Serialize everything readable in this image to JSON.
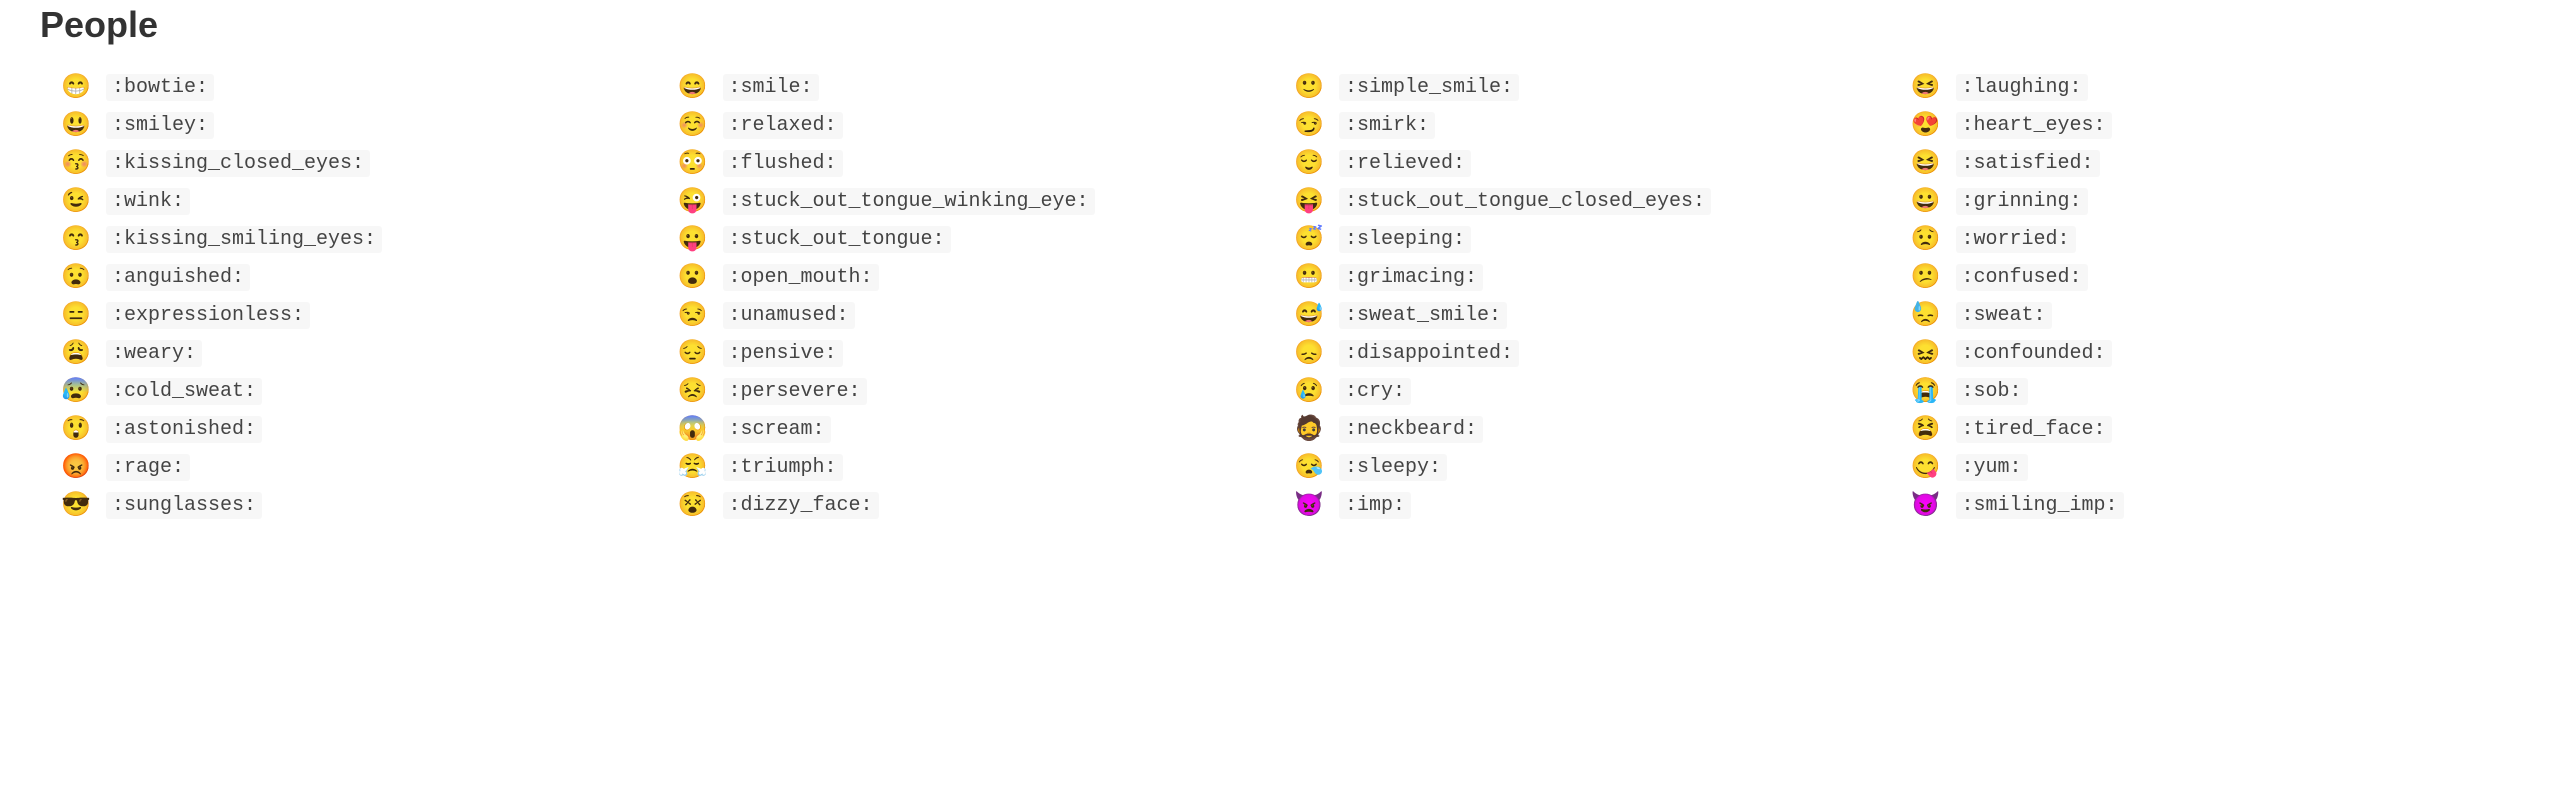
{
  "section": {
    "title": "People"
  },
  "emojis": [
    {
      "name": "bowtie",
      "code": ":bowtie:",
      "glyph": "😁"
    },
    {
      "name": "smile",
      "code": ":smile:",
      "glyph": "😄"
    },
    {
      "name": "simple_smile",
      "code": ":simple_smile:",
      "glyph": "🙂"
    },
    {
      "name": "laughing",
      "code": ":laughing:",
      "glyph": "😆"
    },
    {
      "name": "smiley",
      "code": ":smiley:",
      "glyph": "😃"
    },
    {
      "name": "relaxed",
      "code": ":relaxed:",
      "glyph": "☺️"
    },
    {
      "name": "smirk",
      "code": ":smirk:",
      "glyph": "😏"
    },
    {
      "name": "heart_eyes",
      "code": ":heart_eyes:",
      "glyph": "😍"
    },
    {
      "name": "kissing_closed_eyes",
      "code": ":kissing_closed_eyes:",
      "glyph": "😚"
    },
    {
      "name": "flushed",
      "code": ":flushed:",
      "glyph": "😳"
    },
    {
      "name": "relieved",
      "code": ":relieved:",
      "glyph": "😌"
    },
    {
      "name": "satisfied",
      "code": ":satisfied:",
      "glyph": "😆"
    },
    {
      "name": "wink",
      "code": ":wink:",
      "glyph": "😉"
    },
    {
      "name": "stuck_out_tongue_winking_eye",
      "code": ":stuck_out_tongue_winking_eye:",
      "glyph": "😜"
    },
    {
      "name": "stuck_out_tongue_closed_eyes",
      "code": ":stuck_out_tongue_closed_eyes:",
      "glyph": "😝"
    },
    {
      "name": "grinning",
      "code": ":grinning:",
      "glyph": "😀"
    },
    {
      "name": "kissing_smiling_eyes",
      "code": ":kissing_smiling_eyes:",
      "glyph": "😙"
    },
    {
      "name": "stuck_out_tongue",
      "code": ":stuck_out_tongue:",
      "glyph": "😛"
    },
    {
      "name": "sleeping",
      "code": ":sleeping:",
      "glyph": "😴"
    },
    {
      "name": "worried",
      "code": ":worried:",
      "glyph": "😟"
    },
    {
      "name": "anguished",
      "code": ":anguished:",
      "glyph": "😧"
    },
    {
      "name": "open_mouth",
      "code": ":open_mouth:",
      "glyph": "😮"
    },
    {
      "name": "grimacing",
      "code": ":grimacing:",
      "glyph": "😬"
    },
    {
      "name": "confused",
      "code": ":confused:",
      "glyph": "😕"
    },
    {
      "name": "expressionless",
      "code": ":expressionless:",
      "glyph": "😑"
    },
    {
      "name": "unamused",
      "code": ":unamused:",
      "glyph": "😒"
    },
    {
      "name": "sweat_smile",
      "code": ":sweat_smile:",
      "glyph": "😅"
    },
    {
      "name": "sweat",
      "code": ":sweat:",
      "glyph": "😓"
    },
    {
      "name": "weary",
      "code": ":weary:",
      "glyph": "😩"
    },
    {
      "name": "pensive",
      "code": ":pensive:",
      "glyph": "😔"
    },
    {
      "name": "disappointed",
      "code": ":disappointed:",
      "glyph": "😞"
    },
    {
      "name": "confounded",
      "code": ":confounded:",
      "glyph": "😖"
    },
    {
      "name": "cold_sweat",
      "code": ":cold_sweat:",
      "glyph": "😰"
    },
    {
      "name": "persevere",
      "code": ":persevere:",
      "glyph": "😣"
    },
    {
      "name": "cry",
      "code": ":cry:",
      "glyph": "😢"
    },
    {
      "name": "sob",
      "code": ":sob:",
      "glyph": "😭"
    },
    {
      "name": "astonished",
      "code": ":astonished:",
      "glyph": "😲"
    },
    {
      "name": "scream",
      "code": ":scream:",
      "glyph": "😱"
    },
    {
      "name": "neckbeard",
      "code": ":neckbeard:",
      "glyph": "🧔"
    },
    {
      "name": "tired_face",
      "code": ":tired_face:",
      "glyph": "😫"
    },
    {
      "name": "rage",
      "code": ":rage:",
      "glyph": "😡"
    },
    {
      "name": "triumph",
      "code": ":triumph:",
      "glyph": "😤"
    },
    {
      "name": "sleepy",
      "code": ":sleepy:",
      "glyph": "😪"
    },
    {
      "name": "yum",
      "code": ":yum:",
      "glyph": "😋"
    },
    {
      "name": "sunglasses",
      "code": ":sunglasses:",
      "glyph": "😎"
    },
    {
      "name": "dizzy_face",
      "code": ":dizzy_face:",
      "glyph": "😵"
    },
    {
      "name": "imp",
      "code": ":imp:",
      "glyph": "👿"
    },
    {
      "name": "smiling_imp",
      "code": ":smiling_imp:",
      "glyph": "😈"
    }
  ]
}
